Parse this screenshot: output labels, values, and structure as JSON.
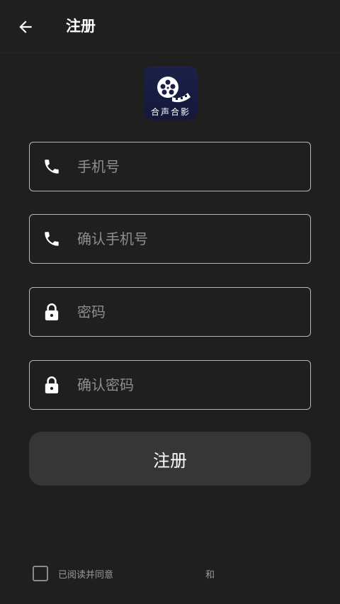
{
  "header": {
    "title": "注册",
    "back_icon": "arrow-left-icon"
  },
  "logo": {
    "text": "合声合影",
    "icon": "film-reel-icon"
  },
  "fields": [
    {
      "placeholder": "手机号",
      "icon": "phone-icon"
    },
    {
      "placeholder": "确认手机号",
      "icon": "phone-icon"
    },
    {
      "placeholder": "密码",
      "icon": "lock-icon"
    },
    {
      "placeholder": "确认密码",
      "icon": "lock-icon"
    }
  ],
  "submit": {
    "label": "注册"
  },
  "agreement": {
    "prefix": "已阅读并同意",
    "and": "和"
  },
  "colors": {
    "background": "#1f1f1f",
    "button": "#363636",
    "border": "#b8b8b8",
    "placeholder": "#8e8e8e"
  }
}
